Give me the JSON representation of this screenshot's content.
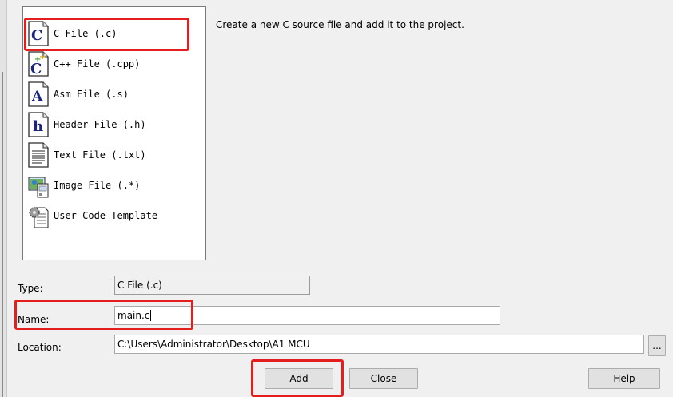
{
  "file_types": [
    {
      "label": "C File (.c)",
      "icon": "c-file-icon"
    },
    {
      "label": "C++ File (.cpp)",
      "icon": "cpp-file-icon"
    },
    {
      "label": "Asm File (.s)",
      "icon": "asm-file-icon"
    },
    {
      "label": "Header File (.h)",
      "icon": "header-file-icon"
    },
    {
      "label": "Text File (.txt)",
      "icon": "text-file-icon"
    },
    {
      "label": "Image File (.*)",
      "icon": "image-file-icon"
    },
    {
      "label": "User Code Template",
      "icon": "template-gear-icon"
    }
  ],
  "description": "Create a new C source file and add it to the project.",
  "form": {
    "type_label": "Type:",
    "type_value": "C File (.c)",
    "name_label": "Name:",
    "name_value": "main.c",
    "location_label": "Location:",
    "location_value": "C:\\Users\\Administrator\\Desktop\\A1 MCU",
    "browse_label": "..."
  },
  "buttons": {
    "add": "Add",
    "close": "Close",
    "help": "Help"
  },
  "highlight_color": "#e41d1d"
}
